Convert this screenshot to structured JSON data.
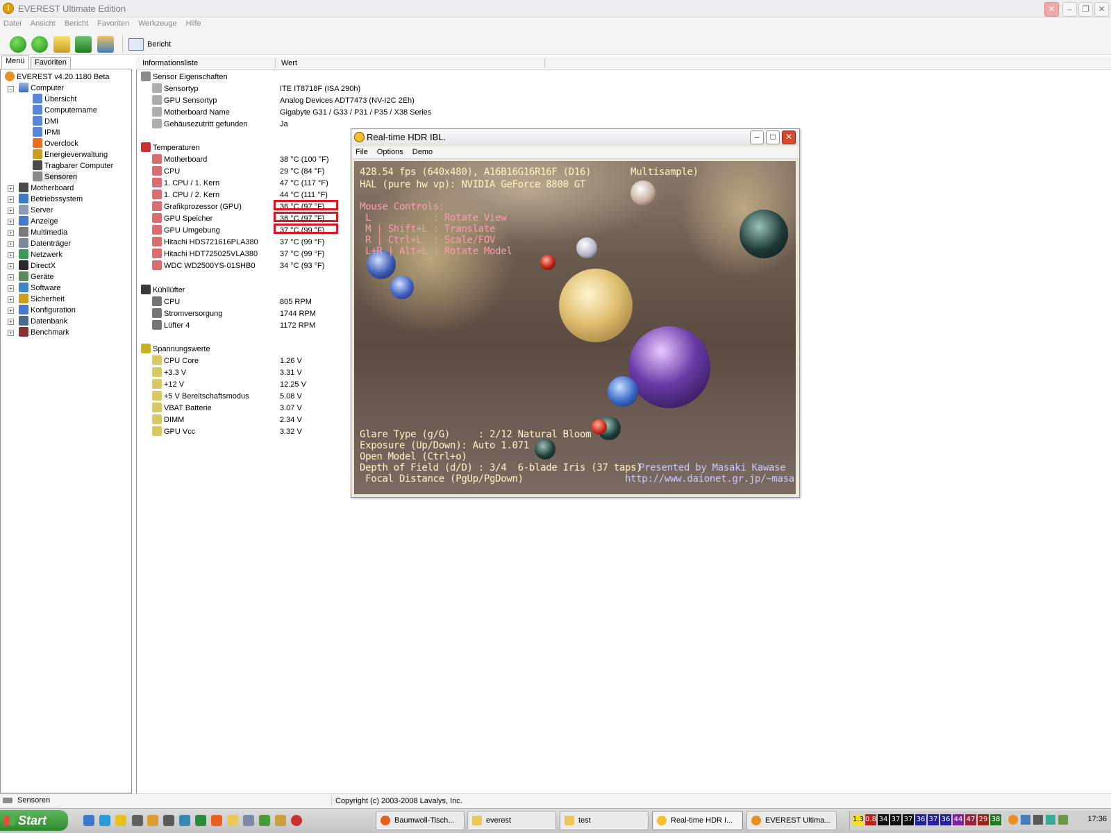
{
  "window": {
    "title": "EVEREST Ultimate Edition"
  },
  "menu": [
    "Datei",
    "Ansicht",
    "Bericht",
    "Favoriten",
    "Werkzeuge",
    "Hilfe"
  ],
  "toolbar": {
    "report_label": "Bericht"
  },
  "tabs": {
    "menu": "Menü",
    "favorites": "Favoriten"
  },
  "tree": {
    "root": "EVEREST v4.20.1180 Beta",
    "computer": "Computer",
    "computer_children": [
      "Übersicht",
      "Computername",
      "DMI",
      "IPMI",
      "Overclock",
      "Energieverwaltung",
      "Tragbarer Computer",
      "Sensoren"
    ],
    "categories": [
      "Motherboard",
      "Betriebssystem",
      "Server",
      "Anzeige",
      "Multimedia",
      "Datenträger",
      "Netzwerk",
      "DirectX",
      "Geräte",
      "Software",
      "Sicherheit",
      "Konfiguration",
      "Datenbank",
      "Benchmark"
    ]
  },
  "columns": {
    "name": "Informationsliste",
    "value": "Wert"
  },
  "sections": {
    "sensor": {
      "title": "Sensor Eigenschaften",
      "rows": [
        {
          "name": "Sensortyp",
          "value": "ITE IT8718F  (ISA 290h)"
        },
        {
          "name": "GPU Sensortyp",
          "value": "Analog Devices ADT7473  (NV-I2C 2Eh)"
        },
        {
          "name": "Motherboard Name",
          "value": "Gigabyte G31 / G33 / P31 / P35 / X38 Series"
        },
        {
          "name": "Gehäusezutritt gefunden",
          "value": "Ja"
        }
      ]
    },
    "temps": {
      "title": "Temperaturen",
      "rows": [
        {
          "name": "Motherboard",
          "value": "38 °C  (100 °F)"
        },
        {
          "name": "CPU",
          "value": "29 °C  (84 °F)"
        },
        {
          "name": "1. CPU / 1. Kern",
          "value": "47 °C  (117 °F)"
        },
        {
          "name": "1. CPU / 2. Kern",
          "value": "44 °C  (111 °F)"
        },
        {
          "name": "Grafikprozessor (GPU)",
          "value": "36 °C  (97 °F)"
        },
        {
          "name": "GPU Speicher",
          "value": "36 °C  (97 °F)"
        },
        {
          "name": "GPU Umgebung",
          "value": "37 °C  (99 °F)"
        },
        {
          "name": "Hitachi HDS721616PLA380",
          "value": "37 °C  (99 °F)"
        },
        {
          "name": "Hitachi HDT725025VLA380",
          "value": "37 °C  (99 °F)"
        },
        {
          "name": "WDC WD2500YS-01SHB0",
          "value": "34 °C  (93 °F)"
        }
      ]
    },
    "fans": {
      "title": "Kühllüfter",
      "rows": [
        {
          "name": "CPU",
          "value": "805 RPM"
        },
        {
          "name": "Stromversorgung",
          "value": "1744 RPM"
        },
        {
          "name": "Lüfter 4",
          "value": "1172 RPM"
        }
      ]
    },
    "volts": {
      "title": "Spannungswerte",
      "rows": [
        {
          "name": "CPU Core",
          "value": "1.26 V"
        },
        {
          "name": "+3.3 V",
          "value": "3.31 V"
        },
        {
          "name": "+12 V",
          "value": "12.25 V"
        },
        {
          "name": "+5 V Bereitschaftsmodus",
          "value": "5.08 V"
        },
        {
          "name": "VBAT Batterie",
          "value": "3.07 V"
        },
        {
          "name": "DIMM",
          "value": "2.34 V"
        },
        {
          "name": "GPU Vcc",
          "value": "3.32 V"
        }
      ]
    }
  },
  "hdr": {
    "title": "Real-time HDR IBL.",
    "menu": [
      "File",
      "Options",
      "Demo"
    ],
    "fps": "428.54 fps (640x480), A16B16G16R16F (D16)       Multisample)",
    "hal": "HAL (pure hw vp): NVIDIA GeForce 8800 GT",
    "mouse_title": "Mouse Controls:",
    "controls": [
      " L           : Rotate View",
      " M | Shift+L : Translate",
      " R | Ctrl+L  : Scale/FOV",
      " L+R | Alt+L : Rotate Model"
    ],
    "glare": "Glare Type (g/G)     : 2/12 Natural Bloom",
    "exposure": "Exposure (Up/Down): Auto 1.071",
    "open_model": "Open Model (Ctrl+o)",
    "dof": "Depth of Field (d/D) : 3/4  6-blade Iris (37 taps)",
    "focal": " Focal Distance (PgUp/PgDown)",
    "presented": "Presented by Masaki Kawase",
    "url": "http://www.daionet.gr.jp/~masa"
  },
  "status": {
    "left": "Sensoren",
    "right": "Copyright (c) 2003-2008 Lavalys, Inc."
  },
  "taskbar": {
    "start": "Start",
    "tasks": [
      "Baumwoll-Tisch...",
      "everest",
      "test",
      "Real-time HDR I...",
      "EVEREST Ultima..."
    ],
    "tray_values": [
      "1.3",
      "0.8",
      "34",
      "37",
      "37",
      "36",
      "37",
      "36",
      "44",
      "47",
      "29",
      "38"
    ],
    "tray_colors": [
      "#f4e020",
      "#c02020",
      "#101010",
      "#101010",
      "#101010",
      "#2020a0",
      "#2020a0",
      "#2020a0",
      "#8020a0",
      "#a02040",
      "#a02020",
      "#208020"
    ],
    "clock": "17:36"
  }
}
